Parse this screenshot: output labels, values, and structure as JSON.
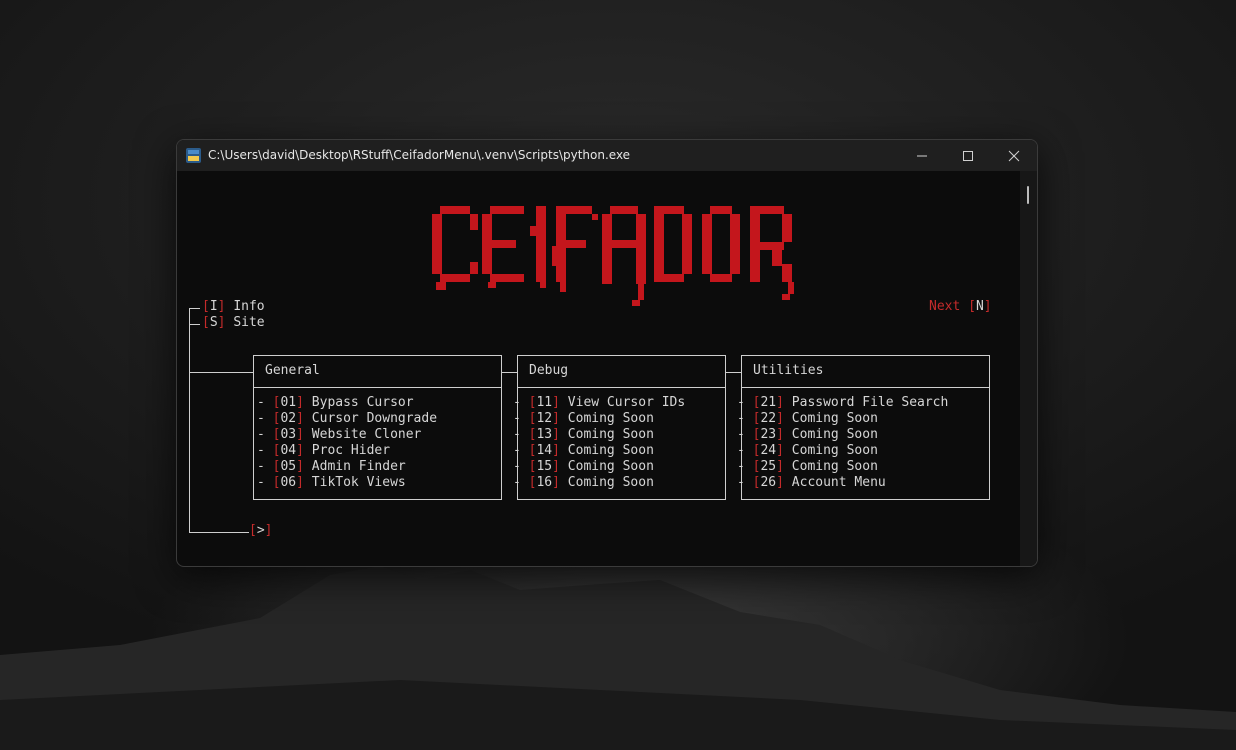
{
  "window": {
    "title": "C:\\Users\\david\\Desktop\\RStuff\\CeifadorMenu\\.venv\\Scripts\\python.exe"
  },
  "logo_text": "CEIFADOR",
  "colors": {
    "accent": "#c42b2b",
    "text": "#d6d6d6",
    "background": "#0c0c0c",
    "titlebar": "#1f1f1f"
  },
  "top_menu": [
    {
      "key": "I",
      "label": "Info"
    },
    {
      "key": "S",
      "label": "Site"
    }
  ],
  "next": {
    "label": "Next",
    "key": "N"
  },
  "panels": [
    {
      "title": "General",
      "items": [
        {
          "num": "01",
          "label": "Bypass Cursor"
        },
        {
          "num": "02",
          "label": "Cursor Downgrade"
        },
        {
          "num": "03",
          "label": "Website Cloner"
        },
        {
          "num": "04",
          "label": "Proc Hider"
        },
        {
          "num": "05",
          "label": "Admin Finder"
        },
        {
          "num": "06",
          "label": "TikTok Views"
        }
      ]
    },
    {
      "title": "Debug",
      "items": [
        {
          "num": "11",
          "label": "View Cursor IDs"
        },
        {
          "num": "12",
          "label": "Coming Soon"
        },
        {
          "num": "13",
          "label": "Coming Soon"
        },
        {
          "num": "14",
          "label": "Coming Soon"
        },
        {
          "num": "15",
          "label": "Coming Soon"
        },
        {
          "num": "16",
          "label": "Coming Soon"
        }
      ]
    },
    {
      "title": "Utilities",
      "items": [
        {
          "num": "21",
          "label": "Password File Search"
        },
        {
          "num": "22",
          "label": "Coming Soon"
        },
        {
          "num": "23",
          "label": "Coming Soon"
        },
        {
          "num": "24",
          "label": "Coming Soon"
        },
        {
          "num": "25",
          "label": "Coming Soon"
        },
        {
          "num": "26",
          "label": "Account Menu"
        }
      ]
    }
  ],
  "prompt": {
    "symbol": ">"
  }
}
